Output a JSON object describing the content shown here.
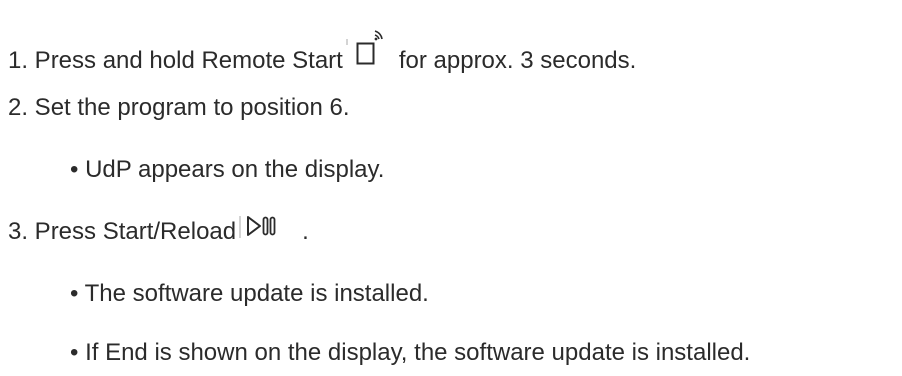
{
  "steps": {
    "step1": {
      "before": "1. Press and hold Remote Start",
      "icon": "remote-start-icon",
      "after": "for approx. 3 seconds."
    },
    "step2": {
      "text": "2. Set the program to position 6."
    },
    "step2_bullet": {
      "text": "• UdP appears on the display."
    },
    "step3": {
      "before": "3. Press Start/Reload",
      "icon": "start-reload-icon",
      "after": "."
    },
    "step3_bullet1": {
      "text": "• The software update is installed."
    },
    "step3_bullet2": {
      "text": "• If End is shown on the display, the software update is installed."
    }
  }
}
